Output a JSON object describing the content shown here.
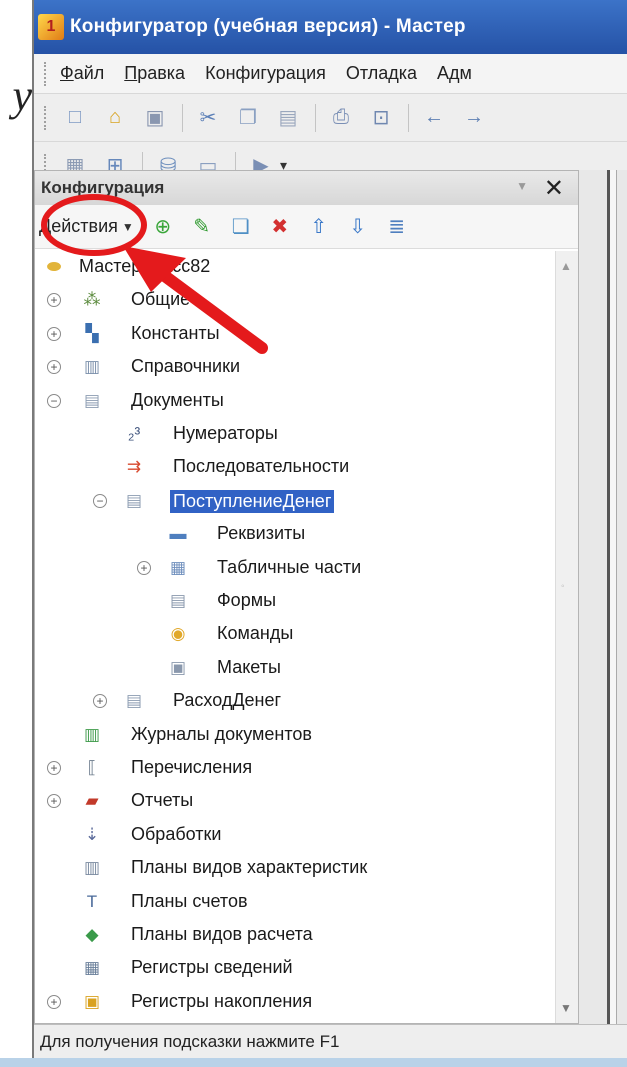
{
  "background_letter": "у",
  "window": {
    "title": "Конфигуратор (учебная версия) - Мастер",
    "menu": [
      {
        "label": "Файл",
        "underline": true
      },
      {
        "label": "Правка",
        "underline": true
      },
      {
        "label": "Конфигурация",
        "underline": false
      },
      {
        "label": "Отладка",
        "underline": false
      },
      {
        "label": "Адм",
        "underline": false
      }
    ],
    "toolbar1_icons": [
      "new-document-icon",
      "open-folder-icon",
      "save-icon",
      "cut-icon",
      "copy-icon",
      "paste-icon",
      "print-icon",
      "print-preview-icon",
      "undo-icon",
      "redo-icon"
    ],
    "toolbar2_icons": [
      "module-icon",
      "config-compare-icon",
      "database-icon",
      "window-icon",
      "run-icon"
    ]
  },
  "panel": {
    "title": "Конфигурация",
    "actions_label": "Действия",
    "toolbar_icons": [
      "add-icon",
      "edit-icon",
      "copy-item-icon",
      "delete-icon",
      "move-up-icon",
      "move-down-icon",
      "sort-icon"
    ]
  },
  "tree": [
    {
      "label": "МастерКласс82",
      "icon": "config-root-icon",
      "expander": "",
      "level": 0
    },
    {
      "label": "Общие",
      "icon": "common-icon",
      "expander": "+",
      "level": 1
    },
    {
      "label": "Константы",
      "icon": "constants-icon",
      "expander": "+",
      "level": 1
    },
    {
      "label": "Справочники",
      "icon": "catalogs-icon",
      "expander": "+",
      "level": 1
    },
    {
      "label": "Документы",
      "icon": "documents-icon",
      "expander": "−",
      "level": 1
    },
    {
      "label": "Нумераторы",
      "icon": "numerators-icon",
      "expander": "",
      "level": 2
    },
    {
      "label": "Последовательности",
      "icon": "sequences-icon",
      "expander": "",
      "level": 2
    },
    {
      "label": "ПоступлениеДенег",
      "icon": "document-icon",
      "expander": "−",
      "level": 2,
      "selected": true
    },
    {
      "label": "Реквизиты",
      "icon": "attributes-icon",
      "expander": "",
      "level": 3
    },
    {
      "label": "Табличные части",
      "icon": "tabular-sections-icon",
      "expander": "+",
      "level": 3
    },
    {
      "label": "Формы",
      "icon": "forms-icon",
      "expander": "",
      "level": 3
    },
    {
      "label": "Команды",
      "icon": "commands-icon",
      "expander": "",
      "level": 3
    },
    {
      "label": "Макеты",
      "icon": "templates-icon",
      "expander": "",
      "level": 3
    },
    {
      "label": "РасходДенег",
      "icon": "document-icon",
      "expander": "+",
      "level": 2
    },
    {
      "label": "Журналы документов",
      "icon": "journals-icon",
      "expander": "",
      "level": 1
    },
    {
      "label": "Перечисления",
      "icon": "enums-icon",
      "expander": "+",
      "level": 1
    },
    {
      "label": "Отчеты",
      "icon": "reports-icon",
      "expander": "+",
      "level": 1
    },
    {
      "label": "Обработки",
      "icon": "data-processors-icon",
      "expander": "",
      "level": 1
    },
    {
      "label": "Планы видов характеристик",
      "icon": "characteristic-types-icon",
      "expander": "",
      "level": 1
    },
    {
      "label": "Планы счетов",
      "icon": "accounts-icon",
      "expander": "",
      "level": 1
    },
    {
      "label": "Планы видов расчета",
      "icon": "calculation-types-icon",
      "expander": "",
      "level": 1
    },
    {
      "label": "Регистры сведений",
      "icon": "info-registers-icon",
      "expander": "",
      "level": 1
    },
    {
      "label": "Регистры накопления",
      "icon": "accumulation-registers-icon",
      "expander": "+",
      "level": 1
    }
  ],
  "status_text": "Для получения подсказки нажмите F1",
  "colors": {
    "annotation_red": "#e41a1c",
    "selection": "#3162c5",
    "titlebar": "#2f63b8"
  }
}
